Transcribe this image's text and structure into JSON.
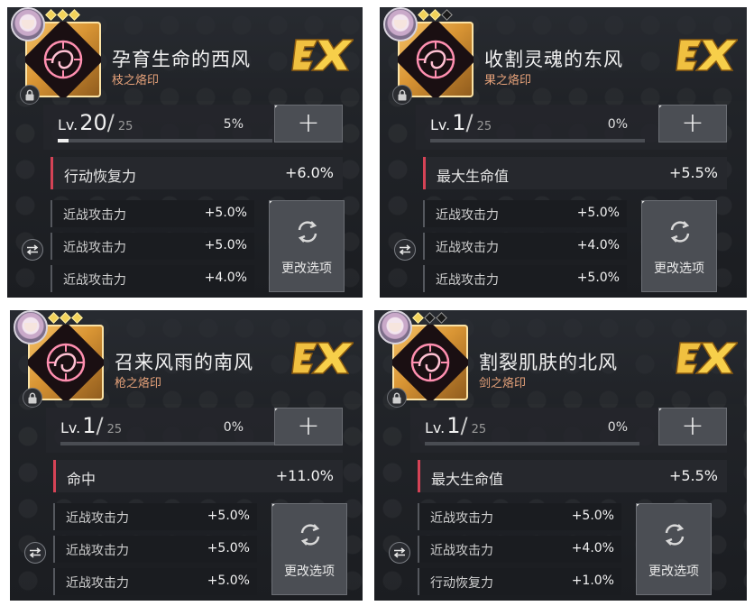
{
  "colors": {
    "accent_red": "#d54356",
    "sub_label": "#e7a27a",
    "gold": "#f2d25a"
  },
  "icons": {
    "plus": "plus-icon",
    "swap": "swap-icon",
    "refresh": "refresh-icon",
    "lock": "lock-icon",
    "ex_badge": "ex-badge"
  },
  "cards": [
    {
      "name": "孕育生命的西风",
      "subtitle": "枝之烙印",
      "stars_filled": 3,
      "stars_total": 3,
      "lv_prefix": "Lv.",
      "level": "20",
      "slash": "/",
      "max_level": "25",
      "percent": "5%",
      "progress": 0.05,
      "main_stat": {
        "label": "行动恢复力",
        "value": "+6.0%"
      },
      "sub_stats": [
        {
          "label": "近战攻击力",
          "value": "+5.0%"
        },
        {
          "label": "近战攻击力",
          "value": "+5.0%"
        },
        {
          "label": "近战攻击力",
          "value": "+4.0%"
        }
      ],
      "change_label": "更改选项"
    },
    {
      "name": "收割灵魂的东风",
      "subtitle": "果之烙印",
      "stars_filled": 2,
      "stars_total": 3,
      "lv_prefix": "Lv.",
      "level": "1",
      "slash": "/",
      "max_level": "25",
      "percent": "0%",
      "progress": 0,
      "main_stat": {
        "label": "最大生命值",
        "value": "+5.5%"
      },
      "sub_stats": [
        {
          "label": "近战攻击力",
          "value": "+5.0%"
        },
        {
          "label": "近战攻击力",
          "value": "+4.0%"
        },
        {
          "label": "近战攻击力",
          "value": "+5.0%"
        }
      ],
      "change_label": "更改选项"
    },
    {
      "name": "召来风雨的南风",
      "subtitle": "枪之烙印",
      "stars_filled": 3,
      "stars_total": 3,
      "lv_prefix": "Lv.",
      "level": "1",
      "slash": "/",
      "max_level": "25",
      "percent": "0%",
      "progress": 0,
      "main_stat": {
        "label": "命中",
        "value": "+11.0%"
      },
      "sub_stats": [
        {
          "label": "近战攻击力",
          "value": "+5.0%"
        },
        {
          "label": "近战攻击力",
          "value": "+5.0%"
        },
        {
          "label": "近战攻击力",
          "value": "+5.0%"
        }
      ],
      "change_label": "更改选项"
    },
    {
      "name": "割裂肌肤的北风",
      "subtitle": "剑之烙印",
      "stars_filled": 1,
      "stars_total": 3,
      "lv_prefix": "Lv.",
      "level": "1",
      "slash": "/",
      "max_level": "25",
      "percent": "0%",
      "progress": 0,
      "main_stat": {
        "label": "最大生命值",
        "value": "+5.5%"
      },
      "sub_stats": [
        {
          "label": "近战攻击力",
          "value": "+5.0%"
        },
        {
          "label": "近战攻击力",
          "value": "+4.0%"
        },
        {
          "label": "行动恢复力",
          "value": "+1.0%"
        }
      ],
      "change_label": "更改选项"
    }
  ]
}
